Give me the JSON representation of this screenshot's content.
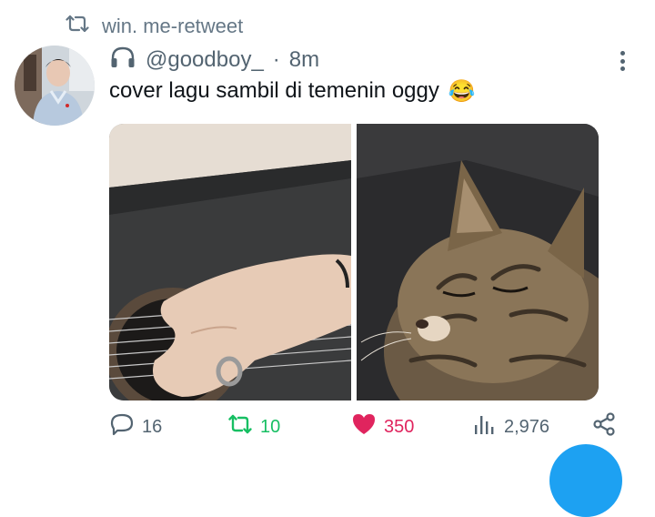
{
  "retweet_banner": {
    "icon": "retweet-icon",
    "text": "win. me-retweet"
  },
  "tweet": {
    "headphones_icon": "headphones-icon",
    "handle": "@goodboy_",
    "separator": "·",
    "time": "8m",
    "text": "cover lagu sambil di temenin oggy",
    "emoji": "😂"
  },
  "actions": {
    "replies": "16",
    "retweets": "10",
    "likes": "350",
    "views": "2,976"
  },
  "colors": {
    "retweet_green": "#17bf63",
    "like_pink": "#e0245e",
    "muted_gray": "#536471",
    "fab_blue": "#1da1f2"
  }
}
